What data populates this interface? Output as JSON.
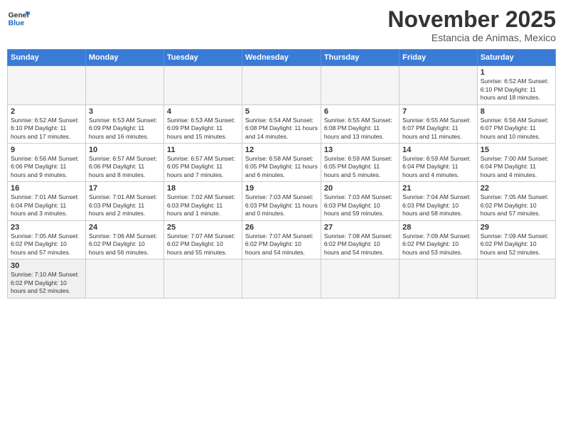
{
  "logo": {
    "general": "General",
    "blue": "Blue"
  },
  "header": {
    "month": "November 2025",
    "location": "Estancia de Animas, Mexico"
  },
  "weekdays": [
    "Sunday",
    "Monday",
    "Tuesday",
    "Wednesday",
    "Thursday",
    "Friday",
    "Saturday"
  ],
  "weeks": [
    [
      {
        "day": "",
        "info": ""
      },
      {
        "day": "",
        "info": ""
      },
      {
        "day": "",
        "info": ""
      },
      {
        "day": "",
        "info": ""
      },
      {
        "day": "",
        "info": ""
      },
      {
        "day": "",
        "info": ""
      },
      {
        "day": "1",
        "info": "Sunrise: 6:52 AM\nSunset: 6:10 PM\nDaylight: 11 hours\nand 18 minutes."
      }
    ],
    [
      {
        "day": "2",
        "info": "Sunrise: 6:52 AM\nSunset: 6:10 PM\nDaylight: 11 hours\nand 17 minutes."
      },
      {
        "day": "3",
        "info": "Sunrise: 6:53 AM\nSunset: 6:09 PM\nDaylight: 11 hours\nand 16 minutes."
      },
      {
        "day": "4",
        "info": "Sunrise: 6:53 AM\nSunset: 6:09 PM\nDaylight: 11 hours\nand 15 minutes."
      },
      {
        "day": "5",
        "info": "Sunrise: 6:54 AM\nSunset: 6:08 PM\nDaylight: 11 hours\nand 14 minutes."
      },
      {
        "day": "6",
        "info": "Sunrise: 6:55 AM\nSunset: 6:08 PM\nDaylight: 11 hours\nand 13 minutes."
      },
      {
        "day": "7",
        "info": "Sunrise: 6:55 AM\nSunset: 6:07 PM\nDaylight: 11 hours\nand 11 minutes."
      },
      {
        "day": "8",
        "info": "Sunrise: 6:56 AM\nSunset: 6:07 PM\nDaylight: 11 hours\nand 10 minutes."
      }
    ],
    [
      {
        "day": "9",
        "info": "Sunrise: 6:56 AM\nSunset: 6:06 PM\nDaylight: 11 hours\nand 9 minutes."
      },
      {
        "day": "10",
        "info": "Sunrise: 6:57 AM\nSunset: 6:06 PM\nDaylight: 11 hours\nand 8 minutes."
      },
      {
        "day": "11",
        "info": "Sunrise: 6:57 AM\nSunset: 6:05 PM\nDaylight: 11 hours\nand 7 minutes."
      },
      {
        "day": "12",
        "info": "Sunrise: 6:58 AM\nSunset: 6:05 PM\nDaylight: 11 hours\nand 6 minutes."
      },
      {
        "day": "13",
        "info": "Sunrise: 6:59 AM\nSunset: 6:05 PM\nDaylight: 11 hours\nand 5 minutes."
      },
      {
        "day": "14",
        "info": "Sunrise: 6:59 AM\nSunset: 6:04 PM\nDaylight: 11 hours\nand 4 minutes."
      },
      {
        "day": "15",
        "info": "Sunrise: 7:00 AM\nSunset: 6:04 PM\nDaylight: 11 hours\nand 4 minutes."
      }
    ],
    [
      {
        "day": "16",
        "info": "Sunrise: 7:01 AM\nSunset: 6:04 PM\nDaylight: 11 hours\nand 3 minutes."
      },
      {
        "day": "17",
        "info": "Sunrise: 7:01 AM\nSunset: 6:03 PM\nDaylight: 11 hours\nand 2 minutes."
      },
      {
        "day": "18",
        "info": "Sunrise: 7:02 AM\nSunset: 6:03 PM\nDaylight: 11 hours\nand 1 minute."
      },
      {
        "day": "19",
        "info": "Sunrise: 7:03 AM\nSunset: 6:03 PM\nDaylight: 11 hours\nand 0 minutes."
      },
      {
        "day": "20",
        "info": "Sunrise: 7:03 AM\nSunset: 6:03 PM\nDaylight: 10 hours\nand 59 minutes."
      },
      {
        "day": "21",
        "info": "Sunrise: 7:04 AM\nSunset: 6:03 PM\nDaylight: 10 hours\nand 58 minutes."
      },
      {
        "day": "22",
        "info": "Sunrise: 7:05 AM\nSunset: 6:02 PM\nDaylight: 10 hours\nand 57 minutes."
      }
    ],
    [
      {
        "day": "23",
        "info": "Sunrise: 7:05 AM\nSunset: 6:02 PM\nDaylight: 10 hours\nand 57 minutes."
      },
      {
        "day": "24",
        "info": "Sunrise: 7:06 AM\nSunset: 6:02 PM\nDaylight: 10 hours\nand 56 minutes."
      },
      {
        "day": "25",
        "info": "Sunrise: 7:07 AM\nSunset: 6:02 PM\nDaylight: 10 hours\nand 55 minutes."
      },
      {
        "day": "26",
        "info": "Sunrise: 7:07 AM\nSunset: 6:02 PM\nDaylight: 10 hours\nand 54 minutes."
      },
      {
        "day": "27",
        "info": "Sunrise: 7:08 AM\nSunset: 6:02 PM\nDaylight: 10 hours\nand 54 minutes."
      },
      {
        "day": "28",
        "info": "Sunrise: 7:09 AM\nSunset: 6:02 PM\nDaylight: 10 hours\nand 53 minutes."
      },
      {
        "day": "29",
        "info": "Sunrise: 7:09 AM\nSunset: 6:02 PM\nDaylight: 10 hours\nand 52 minutes."
      }
    ],
    [
      {
        "day": "30",
        "info": "Sunrise: 7:10 AM\nSunset: 6:02 PM\nDaylight: 10 hours\nand 52 minutes."
      },
      {
        "day": "",
        "info": ""
      },
      {
        "day": "",
        "info": ""
      },
      {
        "day": "",
        "info": ""
      },
      {
        "day": "",
        "info": ""
      },
      {
        "day": "",
        "info": ""
      },
      {
        "day": "",
        "info": ""
      }
    ]
  ]
}
